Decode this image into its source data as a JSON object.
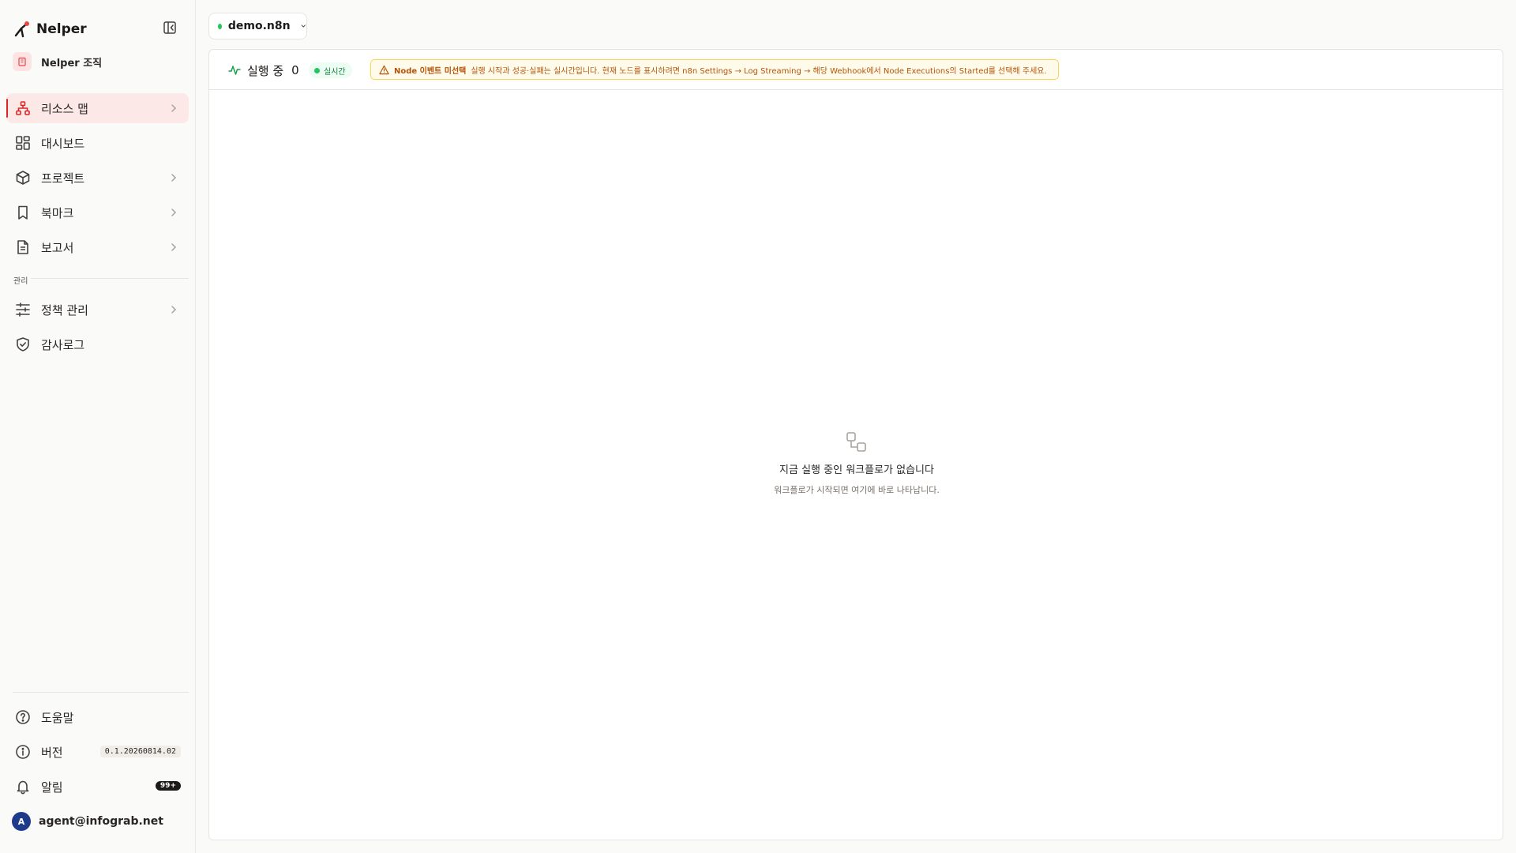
{
  "brand": {
    "name": "Nelper"
  },
  "org": {
    "name": "Nelper 조직"
  },
  "nav": {
    "resource_map": "리소스 맵",
    "dashboard": "대시보드",
    "projects": "프로젝트",
    "bookmarks": "북마크",
    "reports": "보고서",
    "section_admin": "관리",
    "policy": "정책 관리",
    "audit_log": "감사로그"
  },
  "footer": {
    "help": "도움말",
    "version_label": "버전",
    "version_value": "0.1.20260814.02",
    "notifications": "알림",
    "notifications_count": "99+",
    "user_initial": "A",
    "user_email": "agent@infograb.net"
  },
  "env": {
    "name": "demo.n8n",
    "status_color": "#22c55e"
  },
  "header": {
    "running_label": "실행 중",
    "running_count": "0",
    "live_label": "실시간",
    "warning_title": "Node 이벤트 미선택",
    "warning_text": "실행 시작과 성공·실패는 실시간입니다. 현재 노드를 표시하려면 n8n Settings → Log Streaming → 해당 Webhook에서 Node Executions의 Started를 선택해 주세요."
  },
  "empty_state": {
    "title": "지금 실행 중인 워크플로가 없습니다",
    "subtitle": "워크플로가 시작되면 여기에 바로 나타납니다."
  },
  "colors": {
    "accent": "#dc2626",
    "active_bg": "#fde8e8",
    "warning": "#b45309",
    "live": "#22c55e"
  }
}
